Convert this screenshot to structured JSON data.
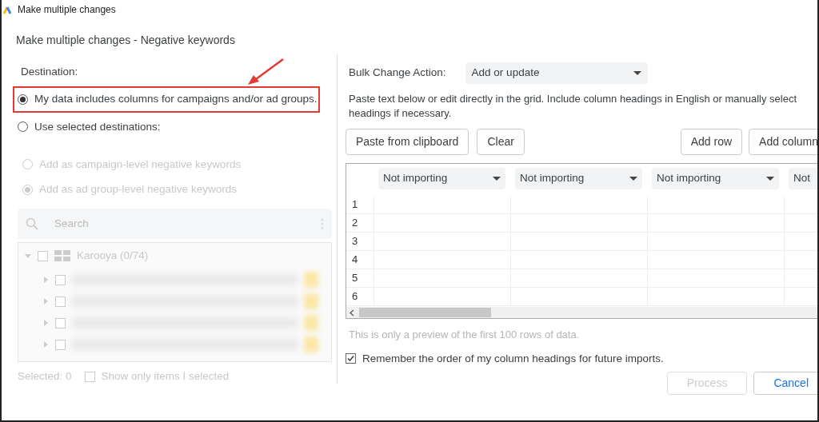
{
  "window": {
    "title": "Make multiple changes"
  },
  "dialog_title": "Make multiple changes - Negative keywords",
  "destination": {
    "label": "Destination:",
    "options": [
      {
        "label": "My data includes columns for campaigns and/or ad groups.",
        "selected": true,
        "highlighted": true
      },
      {
        "label": "Use selected destinations:",
        "selected": false,
        "highlighted": false
      }
    ],
    "sub_options": [
      {
        "label": "Add as campaign-level negative keywords",
        "selected": false,
        "disabled": true
      },
      {
        "label": "Add as ad group-level negative keywords",
        "selected": true,
        "disabled": true
      }
    ],
    "search": {
      "placeholder": "Search"
    },
    "tree": {
      "label": "Karooya (0/74)",
      "expanded": true,
      "checked": false,
      "children": [
        {
          "checked": false,
          "expanded": false
        },
        {
          "checked": false,
          "expanded": false
        },
        {
          "checked": false,
          "expanded": false
        },
        {
          "checked": false,
          "expanded": false
        }
      ]
    },
    "selected_count": "Selected: 0",
    "show_only_selected": {
      "label": "Show only items I selected",
      "checked": false
    }
  },
  "bulk_action": {
    "label": "Bulk Change Action:",
    "value": "Add or update"
  },
  "instructions": "Paste text below or edit directly in the grid. Include column headings in English or manually select headings if necessary.",
  "toolbar_left": [
    "Paste from clipboard",
    "Clear"
  ],
  "toolbar_right": [
    "Add row",
    "Add column"
  ],
  "grid": {
    "columns": [
      "Not importing",
      "Not importing",
      "Not importing",
      "Not"
    ],
    "row_numbers": [
      "1",
      "2",
      "3",
      "4",
      "5",
      "6"
    ]
  },
  "preview_note": "This is only a preview of the first 100 rows of data.",
  "remember_order": {
    "label": "Remember the order of my column headings for future imports.",
    "checked": true
  },
  "footer_buttons": [
    {
      "label": "Process",
      "kind": "button",
      "disabled": true
    },
    {
      "label": "Cancel",
      "kind": "link",
      "disabled": false
    }
  ]
}
